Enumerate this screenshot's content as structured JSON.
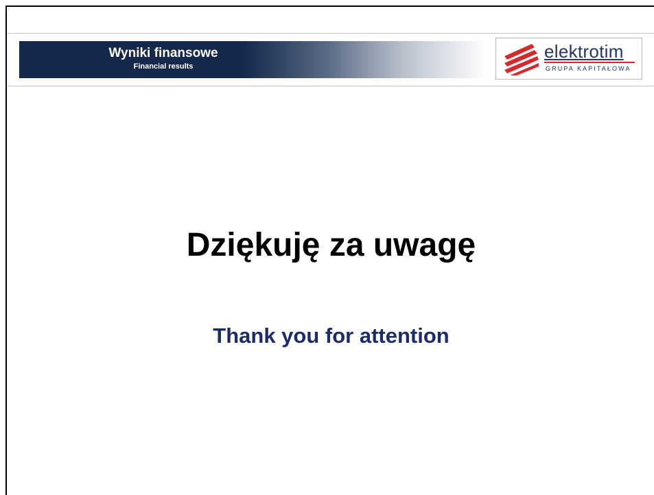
{
  "header": {
    "title": "Wyniki finansowe",
    "subtitle": "Financial results"
  },
  "logo": {
    "name": "elektrotim",
    "tagline": "GRUPA KAPITAŁOWA",
    "icon": "elektrotim-logo-mark",
    "brand_color": "#24356b",
    "accent_color": "#d8282e"
  },
  "content": {
    "heading": "Dziękuję za uwagę",
    "subheading": "Thank you for attention"
  },
  "colors": {
    "band_dark": "#14284c",
    "subheading": "#1c2b69"
  }
}
